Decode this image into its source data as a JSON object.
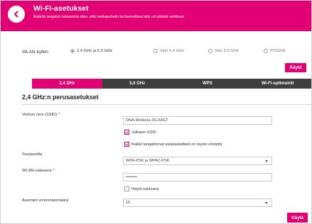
{
  "header": {
    "title": "Wi-Fi-asetukset",
    "subtitle": "Määritä langaton tukiasema siten, että matkapuhelin tai kannettava laite voi päästä verkkoon",
    "back_icon": "chevron-left-icon"
  },
  "wlan_switch": {
    "label": "WLAN-kytkin",
    "options": [
      {
        "label": "2,4 GHz ja 5,0 GHz",
        "checked": true
      },
      {
        "label": "Vain 2,4 GHz",
        "checked": false
      },
      {
        "label": "Vain 5,0 GHz",
        "checked": false
      },
      {
        "label": "POISSA",
        "checked": false
      }
    ],
    "apply_label": "Käytä"
  },
  "tabs": [
    {
      "label": "2,4 GHz",
      "active": true
    },
    {
      "label": "5,0 GHz",
      "active": false
    },
    {
      "label": "WPS",
      "active": false
    },
    {
      "label": "Wi-Fi-optimointi",
      "active": false
    }
  ],
  "section": {
    "title": "2,4 GHz:n perusasetukset"
  },
  "form": {
    "ssid_label": "Verkon nimi (SSID)",
    "ssid_value": "DNA-Mokkula-2G-64GT",
    "publish_ssid_label": "Julkaise SSID",
    "publish_ssid_checked": true,
    "isolate_clients_label": "Kaikki langattomat asiakaslaitteet on täysin eristetty",
    "isolate_clients_checked": true,
    "security_label": "Suojaustila",
    "security_value": "WPA-PSK ja WPA2-PSK",
    "password_label": "WLAN-salasana",
    "password_value": "••••••••",
    "show_password_label": "Näytä salasana",
    "show_password_checked": false,
    "max_stations_label": "Asemien enimmäismäärä",
    "max_stations_value": "16",
    "required_mark": "*",
    "apply_label": "Käytä"
  },
  "colors": {
    "brand": "#e20074",
    "tab_bar": "#3d3d3d"
  }
}
